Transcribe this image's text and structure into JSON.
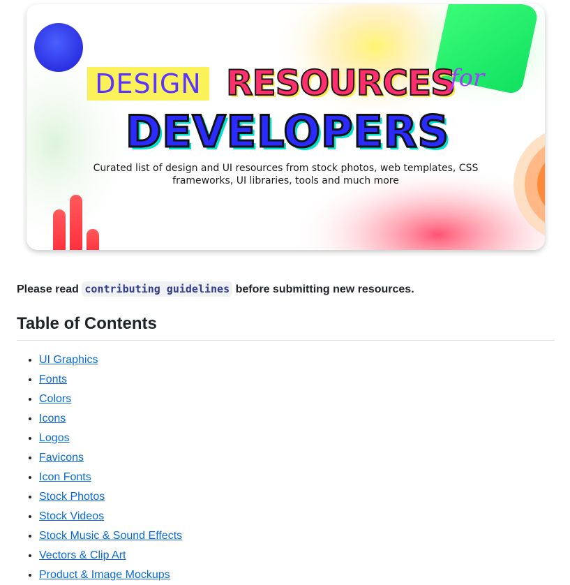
{
  "banner": {
    "title_design": "DESIGN",
    "title_resources": "RESOURCES",
    "title_for": "for",
    "title_developers": "DEVELOPERS",
    "subtitle_line1": "Curated list of design and UI resources from stock photos, web templates, CSS",
    "subtitle_line2": "frameworks, UI libraries, tools and much more",
    "colors": {
      "circle": "#3a45f0",
      "green_shape": "#1ef06a",
      "red_bars": "#ff3a4a",
      "orange_arc": "#ff8a3a",
      "pink_glow": "#ff6b8a",
      "yellow_glow": "#fff36b"
    }
  },
  "notice": {
    "prefix": "Please read",
    "link_code": "contributing guidelines",
    "suffix": "before submitting new resources."
  },
  "toc": {
    "heading": "Table of Contents",
    "items": [
      "UI Graphics",
      "Fonts",
      "Colors",
      "Icons",
      "Logos",
      "Favicons",
      "Icon Fonts",
      "Stock Photos",
      "Stock Videos",
      "Stock Music & Sound Effects",
      "Vectors & Clip Art",
      "Product & Image Mockups"
    ],
    "link_color": "#0969da"
  }
}
